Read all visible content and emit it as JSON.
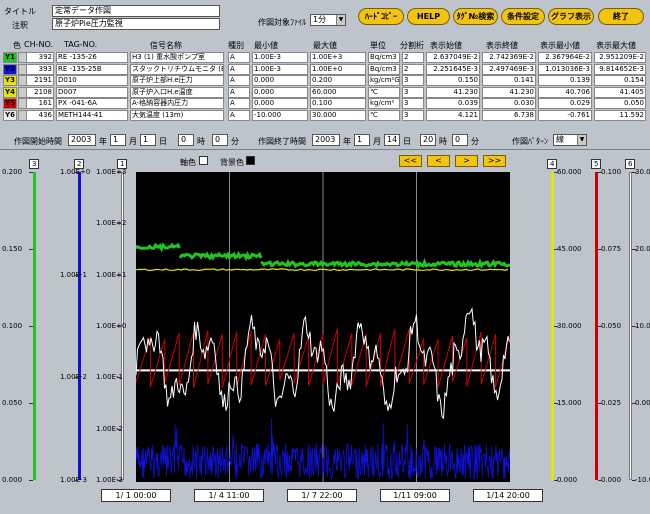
{
  "header": {
    "title_label": "タイトル",
    "title_value": "定常データ作図",
    "note_label": "注釈",
    "note_value": "原子炉Pie圧力監視",
    "file_label": "作図対象ﾌｧｲﾙ",
    "file_value": "1分"
  },
  "toolbar": {
    "hardcopy": "ﾊｰﾄﾞｺﾋﾟｰ",
    "help": "HELP",
    "tag_search": "ﾀｸﾞ№検索",
    "conditions": "条件設定",
    "show_graph": "グラフ表示",
    "exit": "終了"
  },
  "table": {
    "headers": [
      "色",
      "CH-NO.",
      "TAG-NO.",
      "信号名称",
      "種別",
      "最小値",
      "最大値",
      "単位",
      "分割桁",
      "表示始値",
      "表示終値",
      "表示最小値",
      "表示最大値"
    ],
    "rows": [
      {
        "id": "Y1",
        "color": "#22c322",
        "ch": "392",
        "tag": "RE -135-26",
        "name": "H3 (1) 重水酸ポンプ室",
        "type": "A",
        "min": "1.00E-3",
        "max": "1.00E+3",
        "unit": "Bq/cm3",
        "div": "2",
        "start": "2.637049E-2",
        "end": "2.742369E-2",
        "dmin": "2.367964E-2",
        "dmax": "2.951209E-2"
      },
      {
        "id": "Y2",
        "color": "#1010d8",
        "ch": "393",
        "tag": "RE -135-25B",
        "name": "スタックトリチウムモニタ (B)",
        "type": "A",
        "min": "1.00E-3",
        "max": "1.00E+0",
        "unit": "Bq/cm3",
        "div": "2",
        "start": "2.251645E-3",
        "end": "2.497469E-3",
        "dmin": "1.013036E-3",
        "dmax": "9.814652E-3"
      },
      {
        "id": "Y3",
        "color": "#e6e600",
        "ch": "2191",
        "tag": "D010",
        "name": "原子炉上部H.e圧力",
        "type": "A",
        "min": "0.000",
        "max": "0.200",
        "unit": "kg/cm²G",
        "div": "3",
        "start": "0.150",
        "end": "0.141",
        "dmin": "0.139",
        "dmax": "0.154"
      },
      {
        "id": "Y4",
        "color": "#e6e600",
        "ch": "2108",
        "tag": "D007",
        "name": "原子炉入口H.e温度",
        "type": "A",
        "min": "0.000",
        "max": "60.000",
        "unit": "℃",
        "div": "3",
        "start": "41.230",
        "end": "41.230",
        "dmin": "40.706",
        "dmax": "41.405"
      },
      {
        "id": "Y5",
        "color": "#cc0000",
        "ch": "161",
        "tag": "PX -041-6A",
        "name": "A-格納容器内圧力",
        "type": "A",
        "min": "0.000",
        "max": "0.100",
        "unit": "kg/cm²",
        "div": "3",
        "start": "0.039",
        "end": "0.030",
        "dmin": "0.029",
        "dmax": "0.050"
      },
      {
        "id": "Y6",
        "color": "#f0f0f0",
        "ch": "436",
        "tag": "METH144-41",
        "name": "大気温度 (13m)",
        "type": "A",
        "min": "-10.000",
        "max": "30.000",
        "unit": "℃",
        "div": "3",
        "start": "4.121",
        "end": "6.738",
        "dmin": "-0.761",
        "dmax": "11.592"
      }
    ]
  },
  "timerange": {
    "start_label": "作図開始時間",
    "start_year": "2003",
    "start_month": "1",
    "start_day": "1",
    "start_hour": "0",
    "start_min": "0",
    "end_label": "作図終了時間",
    "end_year": "2003",
    "end_month": "1",
    "end_day": "14",
    "end_hour": "20",
    "end_min": "0",
    "u_year": "年",
    "u_month": "月",
    "u_day": "日",
    "u_hour": "時",
    "u_min": "分",
    "pattern_label": "作図ﾊﾟﾀｰﾝ",
    "pattern_value": "線"
  },
  "legend": {
    "axis_color_label": "軸色",
    "bg_color_label": "背景色"
  },
  "nav": {
    "first": "<<",
    "prev": "<",
    "next": ">",
    "last": ">>"
  },
  "chart_data": {
    "type": "line",
    "x_ticks": [
      "1/ 1 00:00",
      "1/ 4 11:00",
      "1/ 7 22:00",
      "1/11 09:00",
      "1/14 20:00"
    ],
    "axes": [
      {
        "id": "3",
        "color": "#22c322",
        "ticks": [
          "0.200",
          "0.150",
          "0.100",
          "0.050",
          "0.000"
        ]
      },
      {
        "id": "2",
        "color": "#1010d8",
        "ticks": [
          "1.00E+0",
          "1.00E-1",
          "1.00E-2",
          "1.00E-3"
        ]
      },
      {
        "id": "1",
        "color": "#ffffff",
        "ticks": [
          "1.00E+3",
          "1.00E+2",
          "1.00E+1",
          "1.00E+0",
          "1.00E-1",
          "1.00E-2",
          "1.00E-3"
        ]
      },
      {
        "id": "4",
        "color": "#e6e600",
        "ticks": [
          "60.000",
          "45.000",
          "30.000",
          "15.000",
          "0.000"
        ]
      },
      {
        "id": "5",
        "color": "#cc0000",
        "ticks": [
          "0.100",
          "0.075",
          "0.050",
          "0.025",
          "0.000"
        ]
      },
      {
        "id": "6",
        "color": "#ffffff",
        "ticks": [
          "30.000",
          "20.000",
          "10.000",
          "0.000",
          "-10.000"
        ]
      }
    ],
    "series": [
      {
        "color": "#22c322",
        "desc": "step",
        "values": [
          0.0275,
          0.0265,
          0.0258,
          0.0256
        ]
      },
      {
        "color": "#e6e600",
        "values": [
          41.2,
          41.1,
          41.0,
          41.2
        ]
      },
      {
        "color": "#ffffff",
        "desc": "flat",
        "values": [
          0.145
        ]
      },
      {
        "color": "#1010d8",
        "desc": "noise",
        "values": [
          0.0025
        ]
      },
      {
        "color": "#cc0000",
        "desc": "sawtooth",
        "values": [
          0.03,
          0.05
        ]
      },
      {
        "color": "#ffffff",
        "desc": "wave",
        "values": [
          -0.7,
          11.5
        ]
      }
    ]
  }
}
